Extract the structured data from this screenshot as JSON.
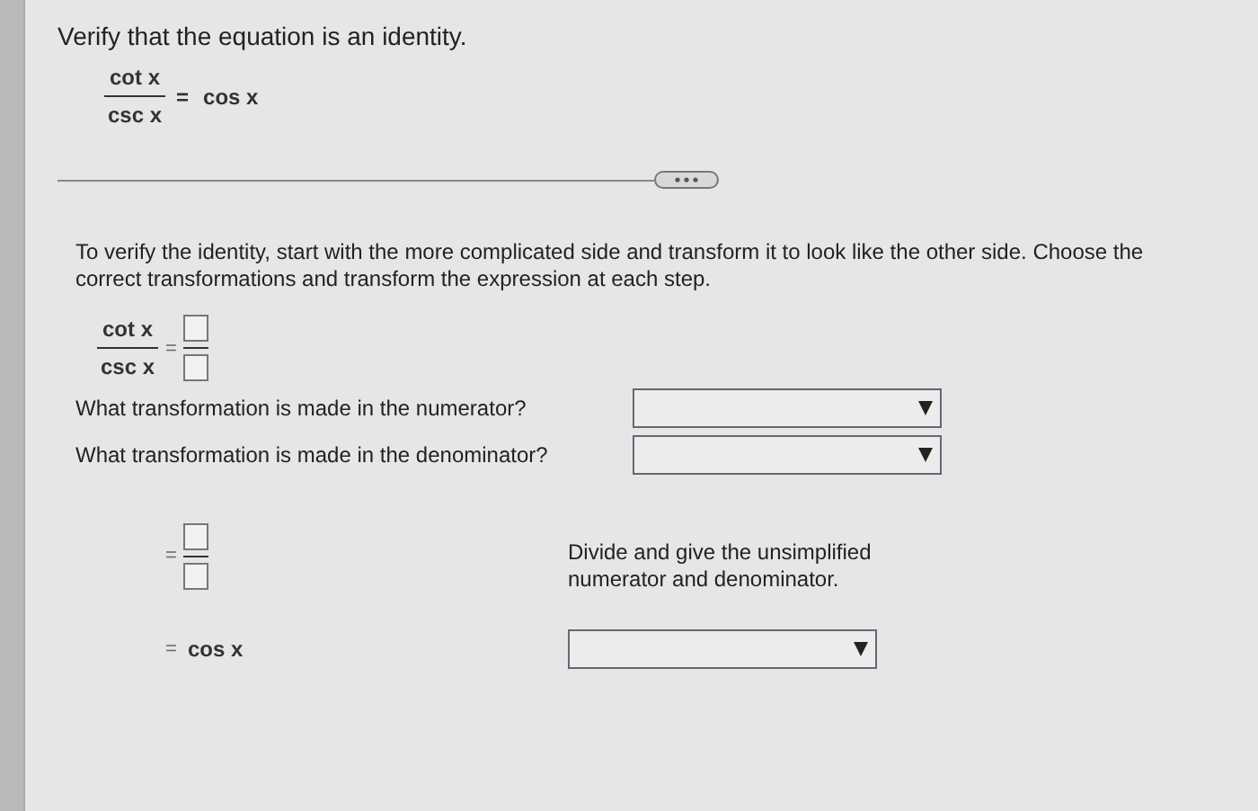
{
  "question": {
    "prompt": "Verify that the equation is an identity.",
    "numerator": "cot x",
    "denominator": "csc x",
    "equals": "=",
    "rhs": "cos x"
  },
  "instructions": "To verify the identity, start with the more complicated side and transform it to look like the other side. Choose the correct transformations and transform the expression at each step.",
  "step1": {
    "numerator": "cot x",
    "denominator": "csc x",
    "equals": "="
  },
  "questions": [
    {
      "label": "What transformation is made in the numerator?"
    },
    {
      "label": "What transformation is made in the denominator?"
    }
  ],
  "step2": {
    "equals": "=",
    "hint": "Divide and give the unsimplified numerator and denominator."
  },
  "step3": {
    "equals": "=",
    "rhs": "cos x"
  }
}
